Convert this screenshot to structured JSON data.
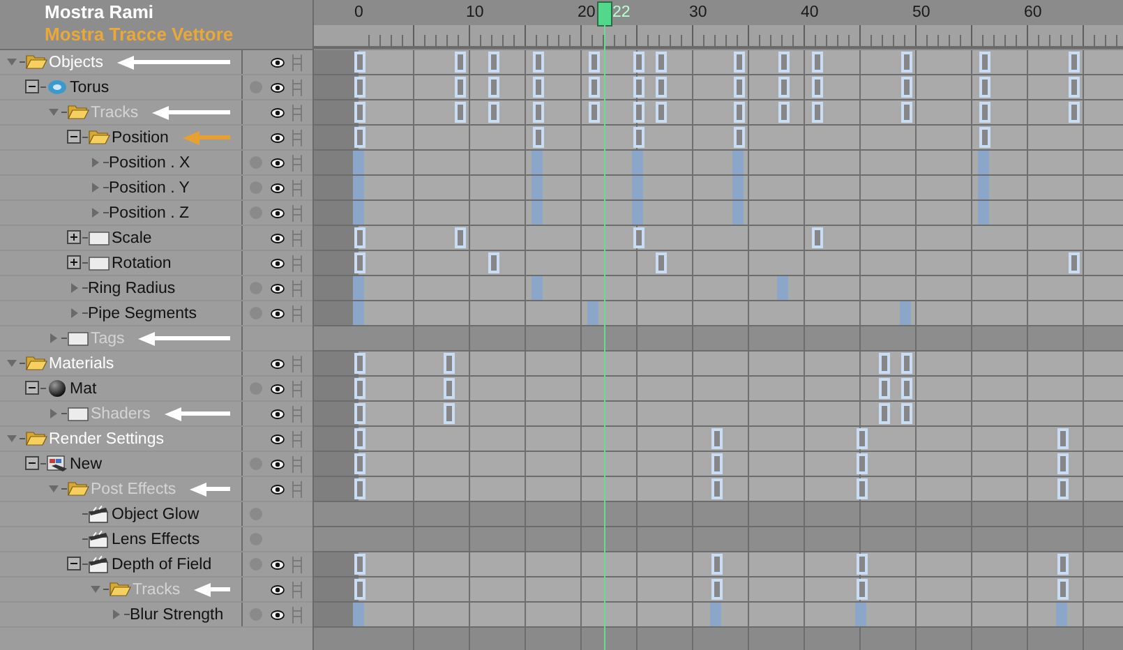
{
  "header": {
    "title": "Mostra Rami",
    "subtitle": "Mostra Tracce Vettore"
  },
  "tree": [
    {
      "label": "Objects",
      "kind": "folder",
      "expanded": true,
      "dimmed": false,
      "dot": false,
      "visible": true,
      "animated": true,
      "color": "#ffffff",
      "children": [
        {
          "label": "Torus",
          "kind": "torus",
          "expanded": true,
          "dimmed": false,
          "dot": true,
          "visible": true,
          "animated": true,
          "children": [
            {
              "label": "Tracks",
              "kind": "folder",
              "expanded": true,
              "dimmed": true,
              "dot": false,
              "visible": true,
              "animated": true,
              "color": "#ffffff",
              "children": [
                {
                  "label": "Position",
                  "kind": "vector",
                  "expanded": true,
                  "dimmed": false,
                  "dot": false,
                  "visible": true,
                  "animated": true,
                  "color": "#e8a030",
                  "children": [
                    {
                      "label": "Position . X",
                      "kind": "param",
                      "expanded": false,
                      "dimmed": false,
                      "dot": true,
                      "visible": true,
                      "animated": true
                    },
                    {
                      "label": "Position . Y",
                      "kind": "param",
                      "expanded": false,
                      "dimmed": false,
                      "dot": true,
                      "visible": true,
                      "animated": true
                    },
                    {
                      "label": "Position . Z",
                      "kind": "param",
                      "expanded": false,
                      "dimmed": false,
                      "dot": true,
                      "visible": true,
                      "animated": true
                    }
                  ]
                },
                {
                  "label": "Scale",
                  "kind": "vector",
                  "expanded": false,
                  "dimmed": false,
                  "dot": false,
                  "visible": true,
                  "animated": true
                },
                {
                  "label": "Rotation",
                  "kind": "vector",
                  "expanded": false,
                  "dimmed": false,
                  "dot": false,
                  "visible": true,
                  "animated": true
                },
                {
                  "label": "Ring Radius",
                  "kind": "param",
                  "expanded": false,
                  "dimmed": false,
                  "dot": true,
                  "visible": true,
                  "animated": true
                },
                {
                  "label": "Pipe Segments",
                  "kind": "param",
                  "expanded": false,
                  "dimmed": false,
                  "dot": true,
                  "visible": true,
                  "animated": true
                }
              ]
            },
            {
              "label": "Tags",
              "kind": "folder",
              "expanded": false,
              "dimmed": true,
              "dot": false,
              "visible": false,
              "animated": false,
              "color": "#ffffff"
            }
          ]
        }
      ]
    },
    {
      "label": "Materials",
      "kind": "folder",
      "expanded": true,
      "dimmed": false,
      "dot": false,
      "visible": true,
      "animated": true,
      "children": [
        {
          "label": "Mat",
          "kind": "material",
          "expanded": true,
          "dimmed": false,
          "dot": true,
          "visible": true,
          "animated": true,
          "children": [
            {
              "label": "Shaders",
              "kind": "folder",
              "expanded": false,
              "dimmed": true,
              "dot": false,
              "visible": true,
              "animated": true,
              "color": "#ffffff"
            }
          ]
        }
      ]
    },
    {
      "label": "Render Settings",
      "kind": "folder",
      "expanded": true,
      "dimmed": false,
      "dot": false,
      "visible": true,
      "animated": true,
      "children": [
        {
          "label": "New",
          "kind": "render",
          "expanded": true,
          "dimmed": false,
          "dot": true,
          "visible": true,
          "animated": true,
          "children": [
            {
              "label": "Post Effects",
              "kind": "folder",
              "expanded": true,
              "dimmed": true,
              "dot": false,
              "visible": true,
              "animated": true,
              "color": "#ffffff",
              "children": [
                {
                  "label": "Object Glow",
                  "kind": "effect",
                  "dimmed": false,
                  "dot": true,
                  "visible": false,
                  "animated": false
                },
                {
                  "label": "Lens Effects",
                  "kind": "effect",
                  "dimmed": false,
                  "dot": true,
                  "visible": false,
                  "animated": false
                },
                {
                  "label": "Depth of Field",
                  "kind": "effect",
                  "expanded": true,
                  "dimmed": false,
                  "dot": true,
                  "visible": true,
                  "animated": true,
                  "children": [
                    {
                      "label": "Tracks",
                      "kind": "folder",
                      "expanded": true,
                      "dimmed": true,
                      "dot": false,
                      "visible": true,
                      "animated": true,
                      "color": "#ffffff",
                      "children": [
                        {
                          "label": "Blur Strength",
                          "kind": "param",
                          "expanded": false,
                          "dimmed": false,
                          "dot": true,
                          "visible": true,
                          "animated": true
                        }
                      ]
                    }
                  ]
                }
              ]
            }
          ]
        }
      ]
    }
  ],
  "ruler": {
    "labels": [
      "0",
      "10",
      "20",
      "30",
      "40",
      "50",
      "60"
    ],
    "current_frame": "22"
  }
}
